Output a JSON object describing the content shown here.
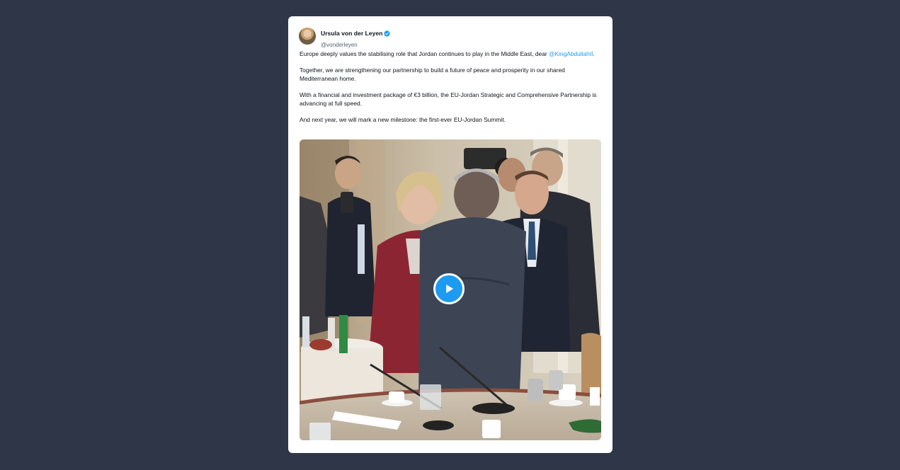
{
  "tweet": {
    "author": {
      "display_name": "Ursula von der Leyen",
      "handle": "@vonderleyen",
      "verified": true,
      "verified_icon": "verified-badge-icon"
    },
    "paragraphs": [
      {
        "before": "Europe deeply values the stabilising role that Jordan continues to play in the Middle East, dear ",
        "mention": "@KingAbdullahII",
        "after": "."
      },
      {
        "text": "Together, we are strengthening our partnership to build a future of peace and prosperity in our shared Mediterranean home."
      },
      {
        "text": "With a financial and investment package of €3 billion, the EU-Jordan Strategic and Comprehensive Partnership is advancing at full speed."
      },
      {
        "text": "And next year, we will mark a new milestone: the first-ever EU-Jordan Summit."
      }
    ],
    "media": {
      "type": "video",
      "play_icon": "play-icon"
    }
  },
  "colors": {
    "page_background": "#2e3647",
    "card_background": "#ffffff",
    "accent": "#1d9bf0",
    "text_primary": "#0f1419",
    "text_secondary": "#536471"
  }
}
